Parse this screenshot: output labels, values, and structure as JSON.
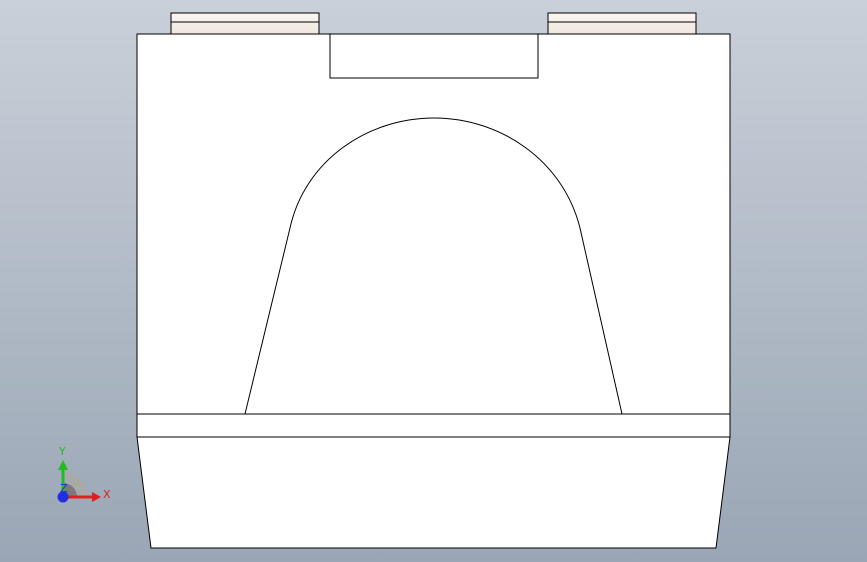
{
  "viewport": {
    "background_top": "#c9d0d9",
    "background_bottom": "#9aa6b5"
  },
  "model": {
    "face_color": "#ffffff",
    "edge_color": "#000000",
    "tab_color": "#f5efe9"
  },
  "triad": {
    "labels": {
      "x": "X",
      "y": "Y",
      "z": "Z"
    },
    "colors": {
      "x": "#e02020",
      "y": "#22bb22",
      "z": "#2030e0"
    }
  }
}
